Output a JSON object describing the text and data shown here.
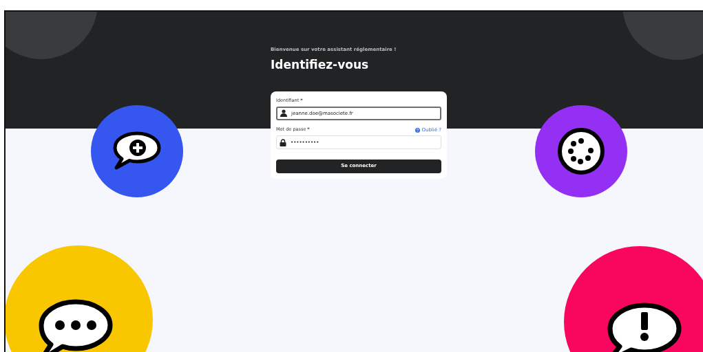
{
  "header": {
    "subtitle": "Bienvenue sur votre assistant réglementaire !",
    "title": "Identifiez-vous"
  },
  "login_form": {
    "fields": [
      {
        "kind": "text",
        "label": "Identifiant",
        "required_mark": "*",
        "value": "jeanne.doe@masociete.fr",
        "focused": true
      },
      {
        "kind": "password",
        "label": "Mot de passe",
        "required_mark": "*",
        "value": "••••••••••",
        "focused": false,
        "help_link": "Oublié ?"
      }
    ],
    "submit_button": "Se connecter"
  }
}
